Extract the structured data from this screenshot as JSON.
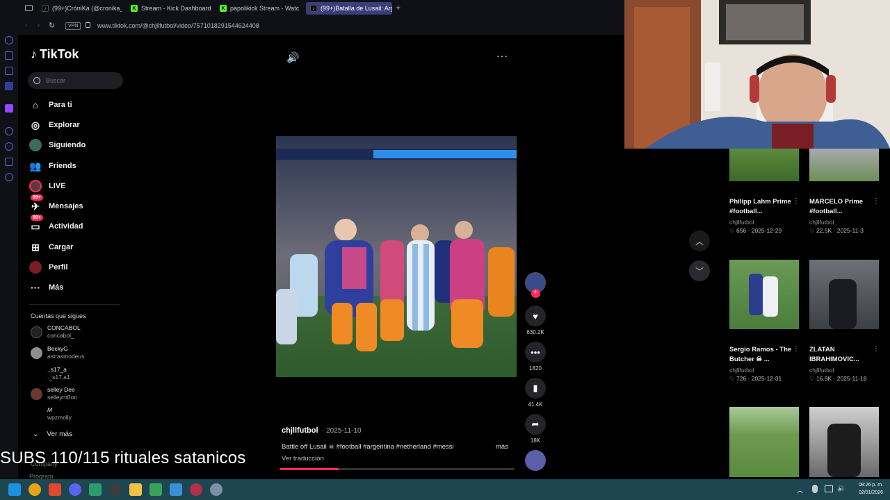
{
  "browser": {
    "tabs": [
      {
        "label": "(99+)CróniKa (@cronika_",
        "color": "#000000",
        "icon": "tiktok-icon"
      },
      {
        "label": "Stream - Kick Dashboard",
        "color": "#53fc18",
        "icon": "kick-icon"
      },
      {
        "label": "papolikick Stream - Watc",
        "color": "#53fc18",
        "icon": "kick-icon"
      },
      {
        "label": "(99+)Batalla de Lusail: Arg",
        "color": "#000000",
        "icon": "tiktok-icon",
        "active": true
      }
    ],
    "vpn_label": "VPN",
    "url": "www.tiktok.com/@chjllfutbol/video/7571018291544624408"
  },
  "tiktok": {
    "logo": "TikTok",
    "search_placeholder": "Buscar",
    "nav": [
      {
        "label": "Para ti",
        "icon": "home-icon"
      },
      {
        "label": "Explorar",
        "icon": "compass-icon"
      },
      {
        "label": "Siguiendo",
        "icon": "following-icon"
      },
      {
        "label": "Friends",
        "icon": "friends-icon"
      },
      {
        "label": "LIVE",
        "icon": "live-icon"
      },
      {
        "label": "Mensajes",
        "icon": "messages-icon",
        "badge": "99+"
      },
      {
        "label": "Actividad",
        "icon": "activity-icon",
        "badge": "99+"
      },
      {
        "label": "Cargar",
        "icon": "upload-icon"
      },
      {
        "label": "Perfil",
        "icon": "profile-icon"
      },
      {
        "label": "Más",
        "icon": "more-icon"
      }
    ],
    "following_heading": "Cuentas que sigues",
    "following": [
      {
        "name": "CONCABOL",
        "handle": "concabol_"
      },
      {
        "name": "BeckyG",
        "handle": "astrasmodeus"
      },
      {
        "name": "..s17_a",
        "handle": "._s17.a1"
      },
      {
        "name": "selley Dee",
        "handle": "selleym0on"
      },
      {
        "name": "M",
        "handle": "wpzmolly"
      }
    ],
    "see_more": "Ver más",
    "footer_1": "Company",
    "footer_2": "Program"
  },
  "video": {
    "author": "chjllfutbol",
    "date": "· 2025-11-10",
    "caption": "Battle off Lusail ☠ #football #argentina #netherland #messi",
    "more": "más",
    "translate": "Ver traducción",
    "progress": 0.25,
    "actions": {
      "likes": "630.2K",
      "comments": "1820",
      "saves": "41.4K",
      "shares": "18K"
    }
  },
  "recommended": [
    {
      "title": "Philipp Lahm Prime #football...",
      "author": "chjllfutbol",
      "stats": "♡ 656 · 2025-12-29"
    },
    {
      "title": "MARCELO Prime #football...",
      "author": "chjllfutbol",
      "stats": "♡ 22.5K · 2025-11-3"
    },
    {
      "title": "Sergio Ramos - The Butcher ☠ ...",
      "author": "chjllfutbol",
      "stats": "♡ 726 · 2025-12-31"
    },
    {
      "title": "ZLATAN IBRAHIMOVIC...",
      "author": "chjllfutbol",
      "stats": "♡ 16.9K · 2025-11-18"
    }
  ],
  "overlay": {
    "subs_text": "SUBS 110/115 rituales satanicos"
  },
  "taskbar": {
    "time": "08:26 p. m.",
    "date": "02/01/2026"
  },
  "colors": {
    "accent": "#fe2c55",
    "taskbar": "#1d4651"
  }
}
